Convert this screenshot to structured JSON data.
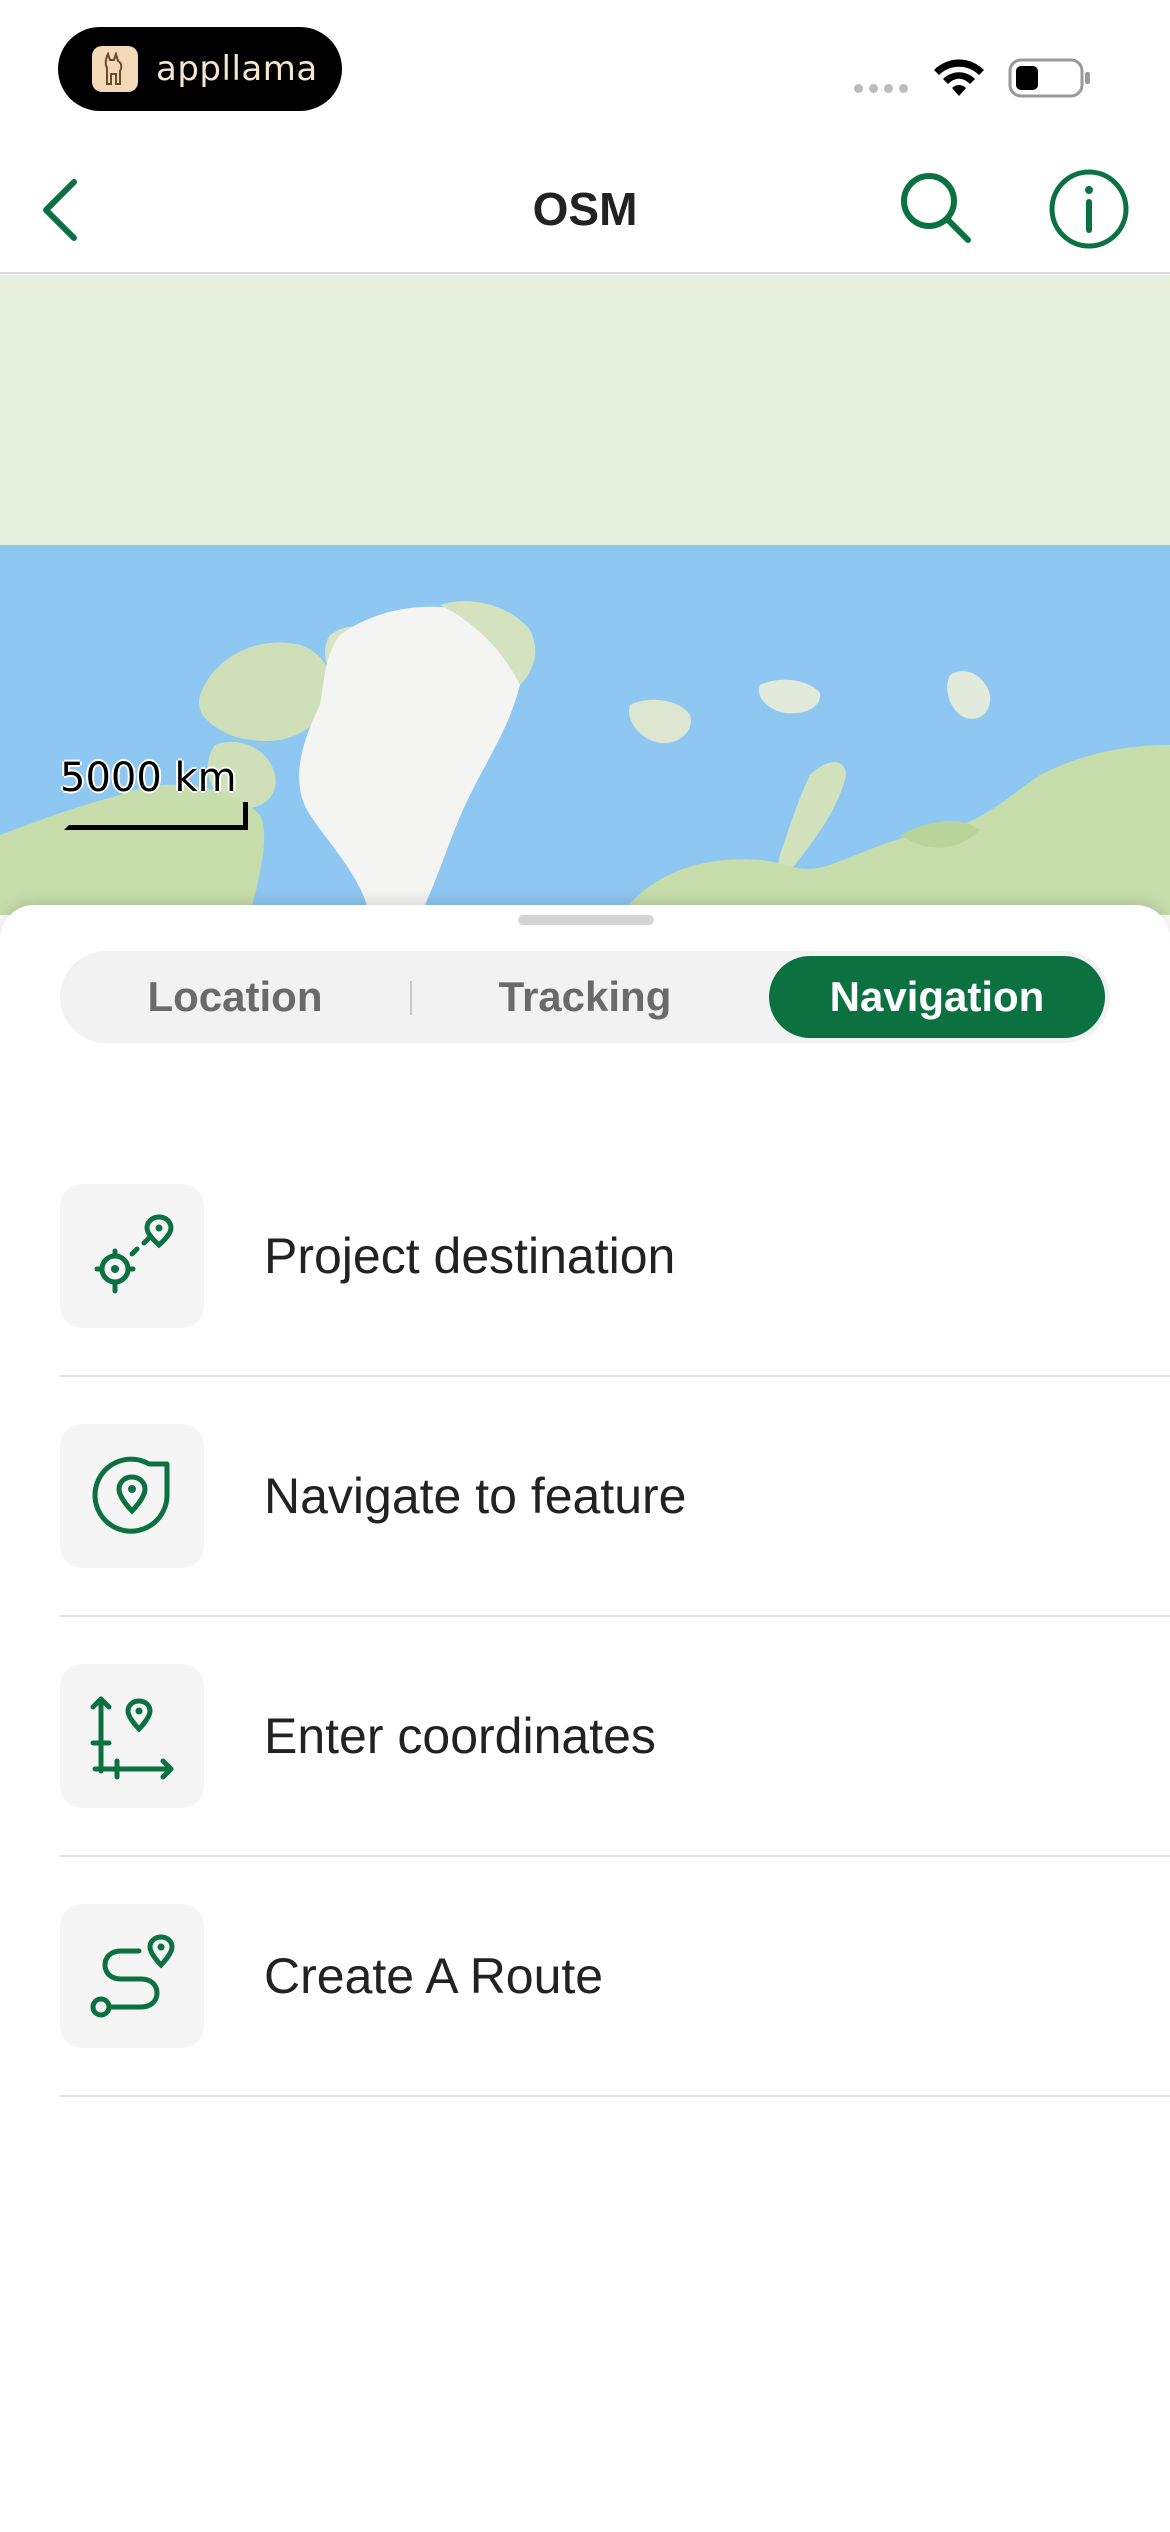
{
  "status_bar": {
    "app_name": "appllama"
  },
  "header": {
    "title": "OSM"
  },
  "map": {
    "scale_label": "5000 km"
  },
  "tabs": [
    {
      "label": "Location",
      "selected": false
    },
    {
      "label": "Tracking",
      "selected": false
    },
    {
      "label": "Navigation",
      "selected": true
    }
  ],
  "items": [
    {
      "label": "Project destination",
      "icon": "project-destination-icon"
    },
    {
      "label": "Navigate to feature",
      "icon": "navigate-to-feature-icon"
    },
    {
      "label": "Enter coordinates",
      "icon": "enter-coordinates-icon"
    },
    {
      "label": "Create A Route",
      "icon": "create-route-icon"
    }
  ],
  "colors": {
    "accent": "#0b7140",
    "map_water": "#8ec7f1",
    "map_land": "#e7f0dc"
  }
}
